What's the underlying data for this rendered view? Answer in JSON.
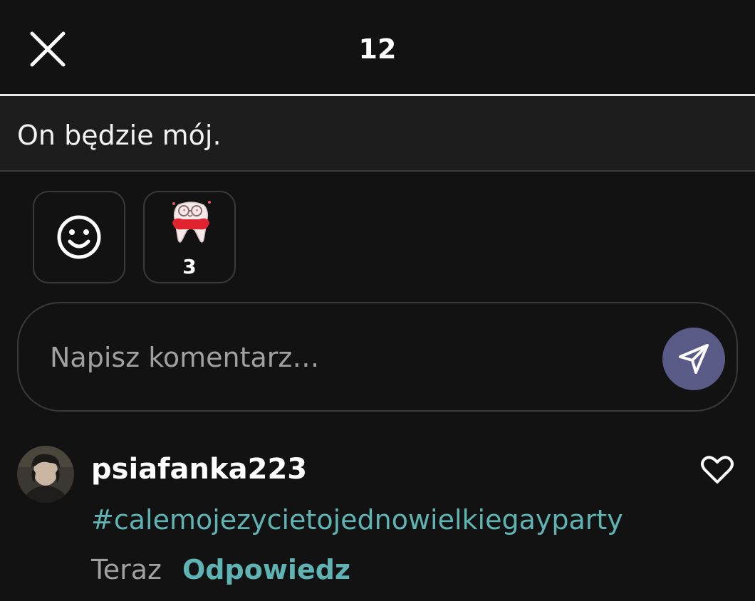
{
  "header": {
    "title": "12",
    "close_icon": "close-icon"
  },
  "quote": {
    "text": "On będzie mój."
  },
  "reactions": {
    "emoji_icon": "smiley-face-icon",
    "sticker": {
      "icon": "cartoon-tooth-sticker-icon",
      "count": "3"
    }
  },
  "comment_box": {
    "placeholder": "Napisz komentarz…",
    "value": "",
    "send_icon": "send-icon",
    "send_color": "#5a5a86"
  },
  "comment": {
    "avatar_icon": "user-avatar",
    "username": "psiafanka223",
    "text": "#calemojezycietojednowielkiegayparty",
    "time": "Teraz",
    "reply_label": "Odpowiedz",
    "like_icon": "heart-outline-icon",
    "accent_color": "#5fb3b3"
  },
  "colors": {
    "background": "#121212",
    "surface": "#1d1d1d",
    "border": "#3a3a3a"
  }
}
